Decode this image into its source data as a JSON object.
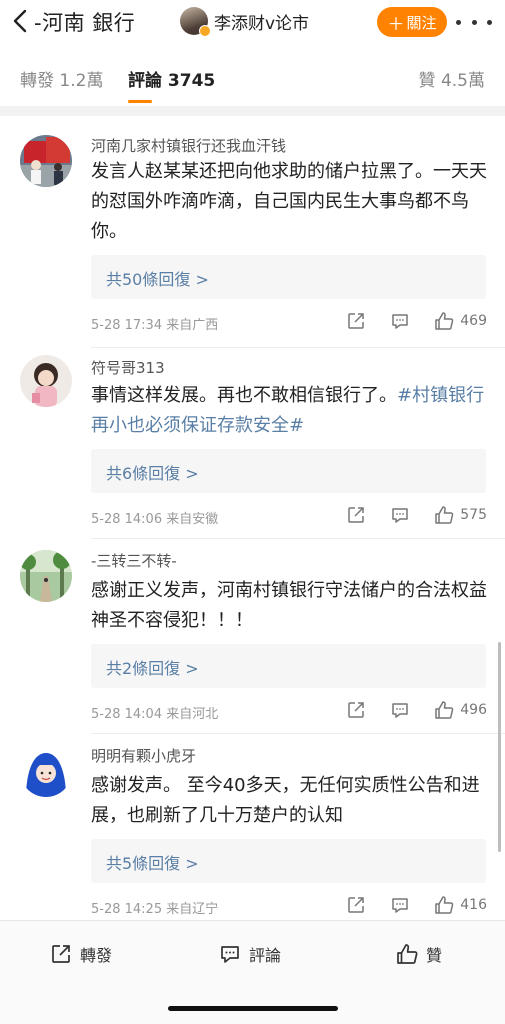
{
  "header": {
    "title": "-河南 銀行",
    "author_name": "李添财v论市",
    "follow_label": "關注",
    "follow_plus": "＋"
  },
  "tabs": {
    "repost": "轉發 1.2萬",
    "comments": "評論 3745",
    "likes": "贊 4.5萬"
  },
  "comments": [
    {
      "name": "河南几家村镇银行还我血汗钱",
      "text": "发言人赵某某还把向他求助的储户拉黑了。一天天的怼国外咋滴咋滴，自己国内民生大事鸟都不鸟你。",
      "hashtag": "",
      "replies": "共50條回復 >",
      "meta": "5-28 17:34  来自广西",
      "likes": "469"
    },
    {
      "name": "符号哥313",
      "text": "事情这样发展。再也不敢相信银行了。",
      "hashtag": "#村镇银行再小也必须保证存款安全#",
      "replies": "共6條回復 >",
      "meta": "5-28 14:06  来自安徽",
      "likes": "575"
    },
    {
      "name": "-三转三不转-",
      "text": "感谢正义发声，河南村镇银行守法储户的合法权益神圣不容侵犯！！！",
      "hashtag": "",
      "replies": "共2條回復 >",
      "meta": "5-28 14:04  来自河北",
      "likes": "496"
    },
    {
      "name": "明明有颗小虎牙",
      "text": "感谢发声。 至今40多天，无任何实质性公告和进展，也刷新了几十万楚户的认知",
      "hashtag": "",
      "replies": "共5條回復 >",
      "meta": "5-28 14:25  来自辽宁",
      "likes": "416"
    }
  ],
  "bottom_bar": {
    "repost": "轉發",
    "comment": "評論",
    "like": "贊"
  },
  "colors": {
    "accent": "#ff8200",
    "link": "#5a7fa6"
  },
  "icons": [
    "back-arrow-icon",
    "verified-icon",
    "more-icon",
    "share-icon",
    "comment-icon",
    "like-icon"
  ]
}
